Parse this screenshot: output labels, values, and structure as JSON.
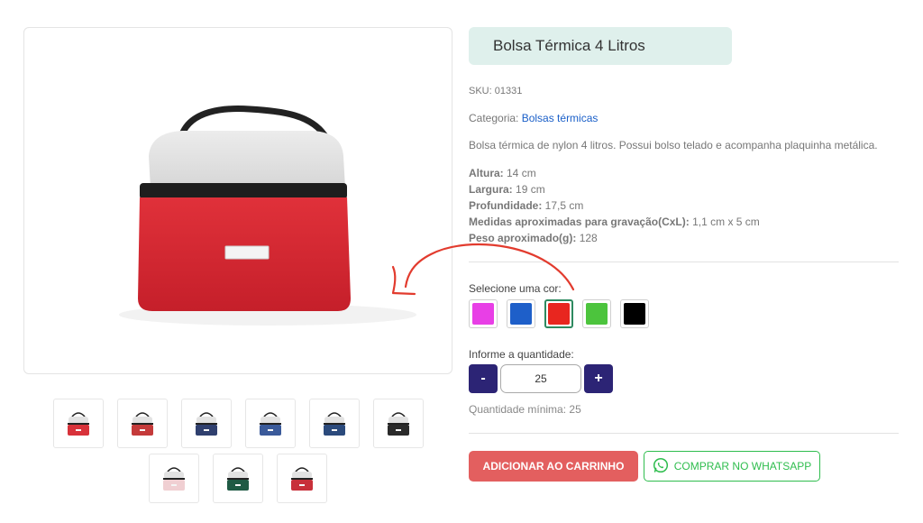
{
  "product": {
    "title": "Bolsa Térmica 4 Litros",
    "sku": "SKU: 01331",
    "category_label": "Categoria: ",
    "category_link": "Bolsas térmicas",
    "description": "Bolsa térmica de nylon 4 litros. Possui bolso telado e acompanha plaquinha metálica.",
    "specs": [
      {
        "label": "Altura:",
        "value": " 14 cm"
      },
      {
        "label": "Largura:",
        "value": " 19 cm"
      },
      {
        "label": "Profundidade:",
        "value": " 17,5 cm"
      },
      {
        "label": "Medidas aproximadas para gravação(CxL):",
        "value": " 1,1 cm x 5 cm"
      },
      {
        "label": "Peso aproximado(g):",
        "value": " 128"
      }
    ]
  },
  "colors": {
    "label": "Selecione uma cor:",
    "options": [
      {
        "name": "magenta",
        "hex": "#e83fe6"
      },
      {
        "name": "blue",
        "hex": "#1e5fc9"
      },
      {
        "name": "red",
        "hex": "#e8261f",
        "selected": true
      },
      {
        "name": "green",
        "hex": "#4cc43d"
      },
      {
        "name": "black",
        "hex": "#000000"
      }
    ]
  },
  "quantity": {
    "label": "Informe a quantidade:",
    "value": "25",
    "minus": "-",
    "plus": "+",
    "minimum": "Quantidade mínima: 25"
  },
  "actions": {
    "add_to_cart": "ADICIONAR AO CARRINHO",
    "whatsapp": "COMPRAR NO WHATSAPP"
  },
  "thumbnails": [
    {
      "icon": "red-bag-thumbnail",
      "color": "#d8323a"
    },
    {
      "icon": "bag-set-thumbnail",
      "color": "#c43a3a"
    },
    {
      "icon": "navy-bag-thumbnail",
      "color": "#2f3f6e"
    },
    {
      "icon": "open-bag-thumbnail",
      "color": "#3a5a9a"
    },
    {
      "icon": "blue-bag-thumbnail",
      "color": "#2b4a7c"
    },
    {
      "icon": "black-bag-thumbnail",
      "color": "#2a2a2a"
    },
    {
      "icon": "pink-bag-thumbnail",
      "color": "#f0cfd2"
    },
    {
      "icon": "green-bag-thumbnail",
      "color": "#1f5a44"
    },
    {
      "icon": "red-bag-thumbnail",
      "color": "#c8303a"
    }
  ],
  "theme": {
    "title_bg": "#dff0ec",
    "link": "#1a5fc8",
    "qty_button": "#2c2475",
    "cart_button": "#e35f5f",
    "whatsapp": "#2fbd4e",
    "annotation": "#e23b2e"
  }
}
